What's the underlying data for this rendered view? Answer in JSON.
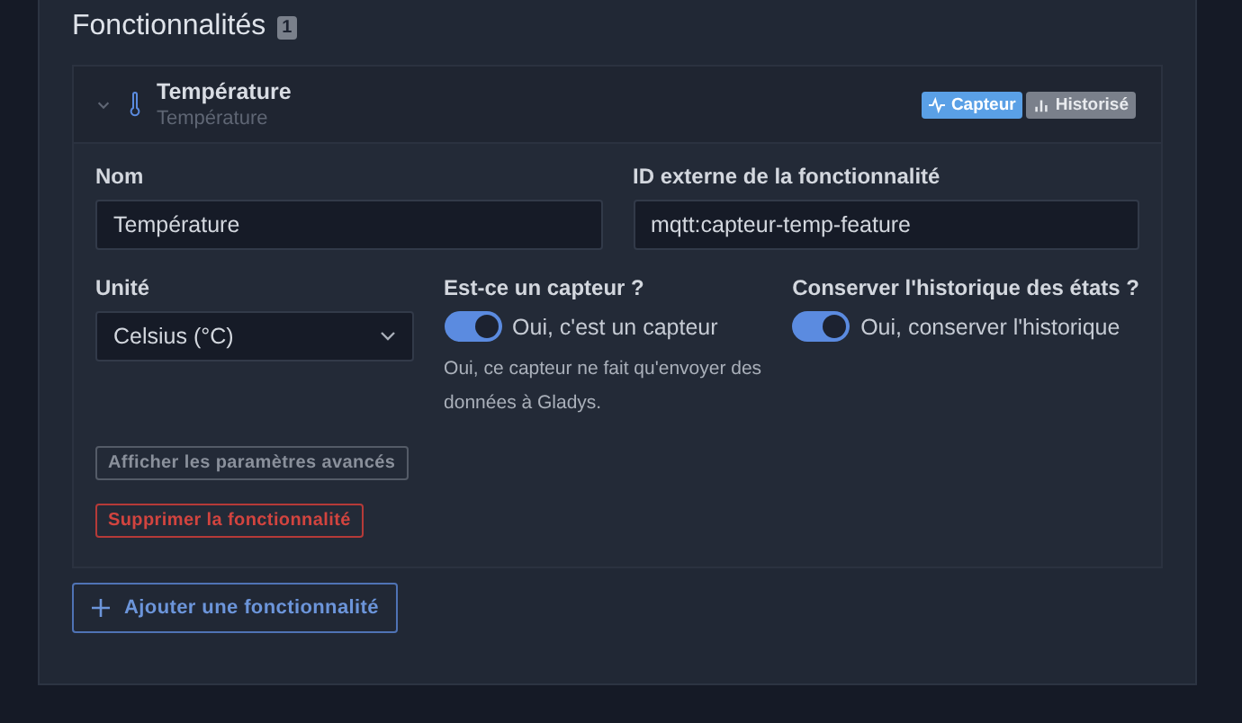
{
  "section": {
    "title": "Fonctionnalités",
    "count": "1"
  },
  "feature": {
    "name": "Température",
    "subtitle": "Température",
    "expanded": true,
    "tags": [
      {
        "label": "Capteur",
        "kind": "sensor"
      },
      {
        "label": "Historisé",
        "kind": "history"
      }
    ],
    "fields": [
      {
        "label": "Nom",
        "value": "Température"
      },
      {
        "label": "ID externe de la fonctionnalité",
        "value": "mqtt:capteur-temp-feature"
      }
    ],
    "unit": {
      "label": "Unité",
      "value": "Celsius (°C)"
    },
    "switches": [
      {
        "label": "Est-ce un capteur ?",
        "text": "Oui, c'est un capteur",
        "on": true,
        "help": "Oui, ce capteur ne fait qu'envoyer des données à Gladys."
      },
      {
        "label": "Conserver l'historique des états ?",
        "text": "Oui, conserver l'historique",
        "on": true
      }
    ],
    "buttons": [
      {
        "label": "Afficher les paramètres avancés",
        "kind": "secondary"
      },
      {
        "label": "Supprimer la fonctionnalité",
        "kind": "danger"
      }
    ]
  },
  "add_button": "Ajouter une fonctionnalité"
}
